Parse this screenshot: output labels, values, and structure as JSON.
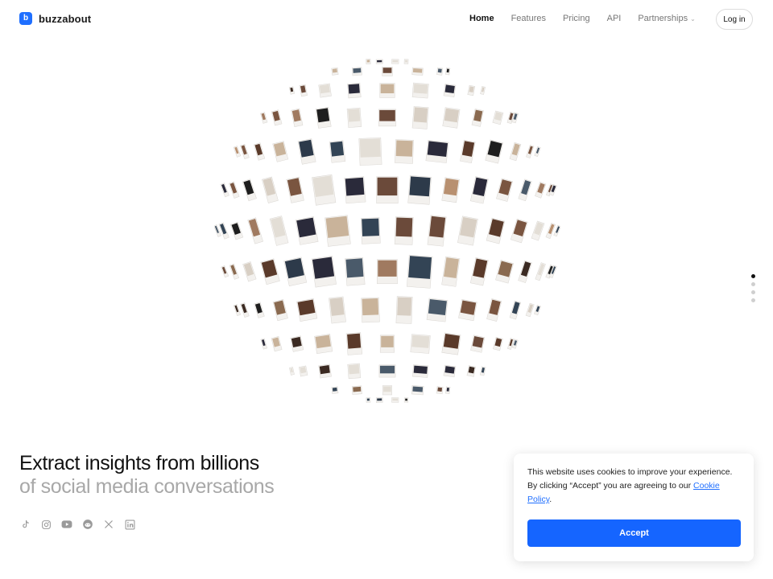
{
  "brand": {
    "name": "buzzabout",
    "logo_icon": "buzzabout-logo-icon",
    "accent": "#1f6fff"
  },
  "nav": {
    "items": [
      {
        "label": "Home",
        "active": true
      },
      {
        "label": "Features"
      },
      {
        "label": "Pricing"
      },
      {
        "label": "API"
      },
      {
        "label": "Partnerships",
        "has_dropdown": true
      }
    ],
    "login_label": "Log in"
  },
  "hero": {
    "title_line1": "Extract insights from billions",
    "title_line2": "of social media conversations",
    "visual": "globe-of-social-media-posts-icon"
  },
  "pagination": {
    "total": 4,
    "active_index": 0
  },
  "socials": [
    {
      "name": "tiktok-icon"
    },
    {
      "name": "instagram-icon"
    },
    {
      "name": "youtube-icon"
    },
    {
      "name": "reddit-icon"
    },
    {
      "name": "x-icon"
    },
    {
      "name": "linkedin-icon"
    }
  ],
  "cookie_banner": {
    "text_before": "This website uses cookies to improve your experience. By clicking “Accept” you are agreeing to our ",
    "link_label": "Cookie Policy",
    "text_after": ".",
    "accept_label": "Accept",
    "button_color": "#1565ff"
  }
}
